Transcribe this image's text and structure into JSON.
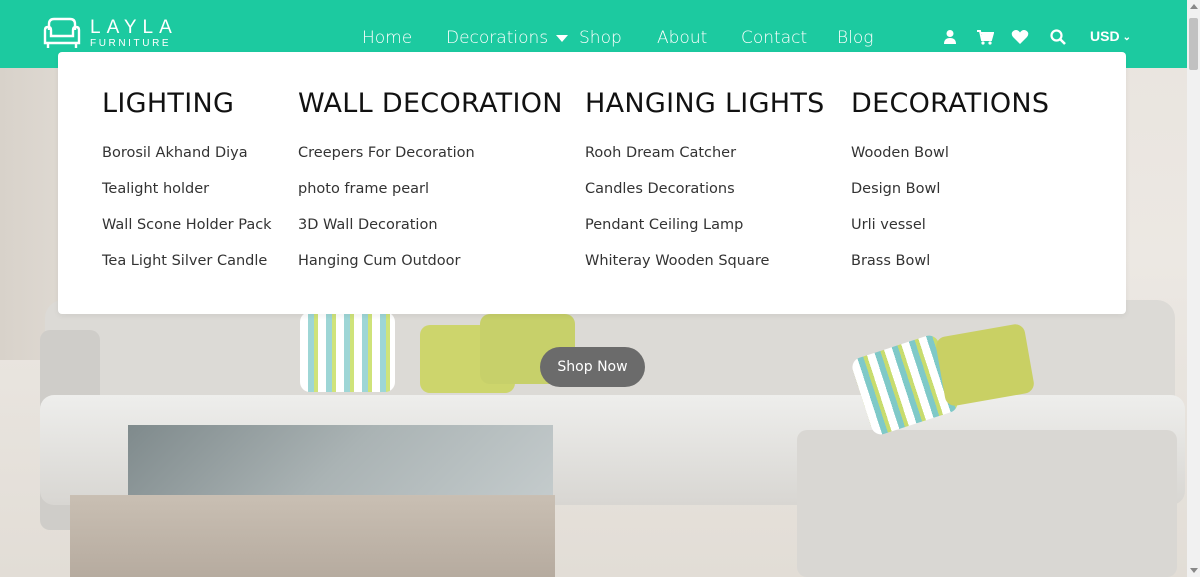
{
  "brand": {
    "name": "LAYLA",
    "subtitle": "FURNITURE",
    "accent_color": "#1ccaa0",
    "logo_icon": "sofa-icon"
  },
  "nav": {
    "items": [
      {
        "label": "Home"
      },
      {
        "label": "Decorations",
        "has_dropdown": true
      },
      {
        "label": "Shop"
      },
      {
        "label": "About"
      },
      {
        "label": "Contact"
      },
      {
        "label": "Blog"
      }
    ]
  },
  "tools": {
    "icons": [
      "user-icon",
      "cart-icon",
      "heart-icon",
      "search-icon"
    ],
    "currency": "USD"
  },
  "mega_menu": {
    "columns": [
      {
        "title": "LIGHTING",
        "items": [
          "Borosil Akhand Diya",
          "Tealight holder",
          "Wall Scone Holder Pack",
          "Tea Light Silver Candle"
        ]
      },
      {
        "title": "WALL DECORATION",
        "items": [
          "Creepers For Decoration",
          "photo frame pearl",
          "3D Wall Decoration",
          "Hanging Cum Outdoor"
        ]
      },
      {
        "title": "HANGING LIGHTS",
        "items": [
          "Rooh Dream Catcher",
          "Candles Decorations",
          "Pendant Ceiling Lamp",
          "Whiteray Wooden Square"
        ]
      },
      {
        "title": "DECORATIONS",
        "items": [
          "Wooden Bowl",
          "Design Bowl",
          "Urli vessel",
          "Brass Bowl"
        ]
      }
    ]
  },
  "hero": {
    "button_label": "Shop Now",
    "button_color": "#6b6b6b"
  }
}
